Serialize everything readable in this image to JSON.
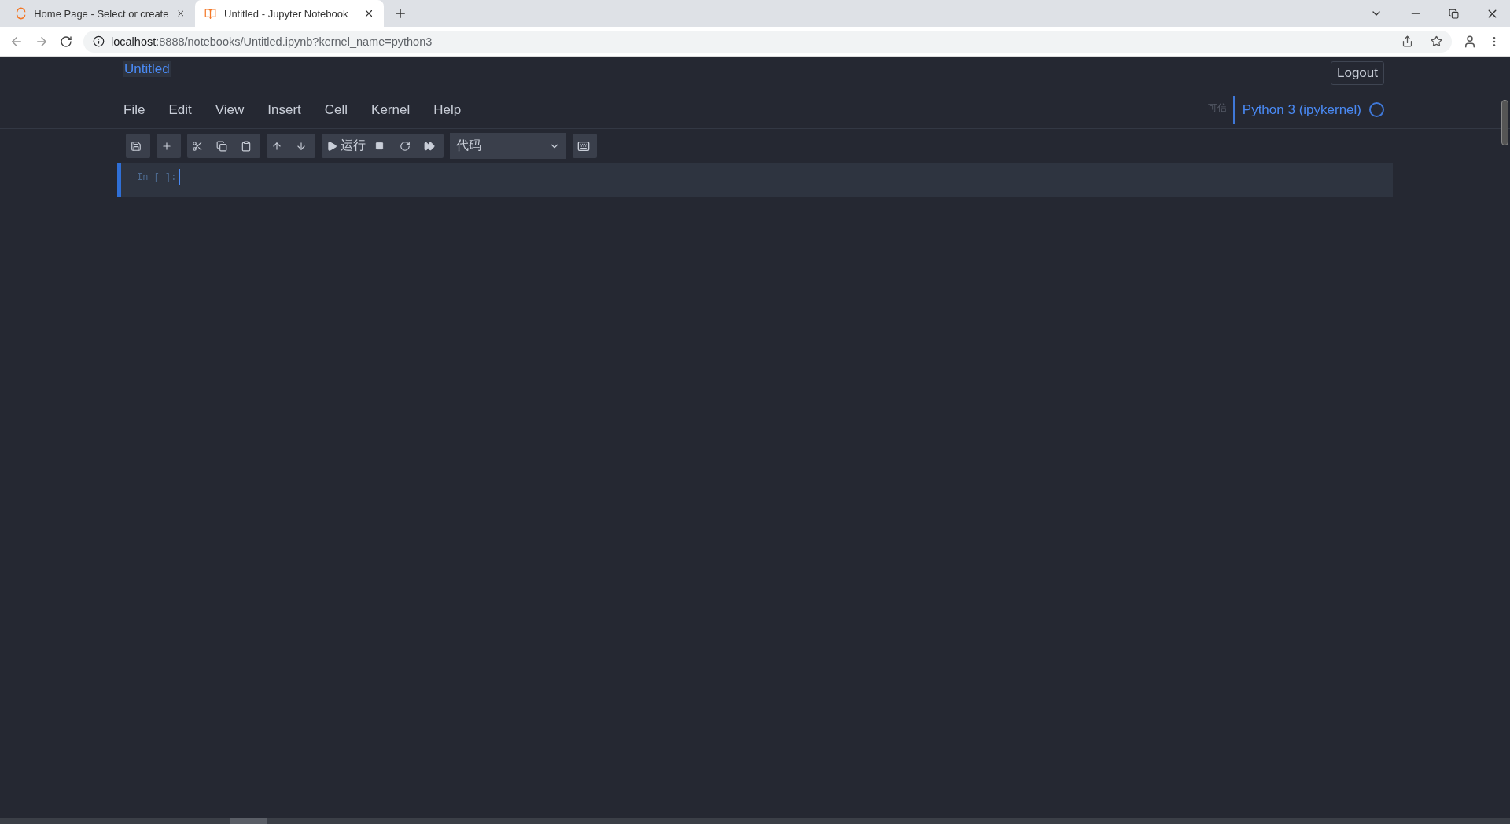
{
  "browser": {
    "tabs": [
      {
        "title": "Home Page - Select or create",
        "selected": false
      },
      {
        "title": "Untitled - Jupyter Notebook",
        "selected": true
      }
    ],
    "address": {
      "host": "localhost",
      "rest": ":8888/notebooks/Untitled.ipynb?kernel_name=python3"
    }
  },
  "notebook": {
    "title": "Untitled",
    "logout": "Logout",
    "menu": [
      "File",
      "Edit",
      "View",
      "Insert",
      "Cell",
      "Kernel",
      "Help"
    ],
    "trusted": "可信",
    "kernel": "Python 3 (ipykernel)",
    "kernel_busy": false
  },
  "toolbar": {
    "groups": [
      [
        {
          "kind": "save"
        }
      ],
      [
        {
          "kind": "add"
        }
      ],
      [
        {
          "kind": "cut"
        },
        {
          "kind": "copy"
        },
        {
          "kind": "paste"
        }
      ],
      [
        {
          "kind": "up"
        },
        {
          "kind": "down"
        }
      ],
      [
        {
          "kind": "run"
        },
        {
          "kind": "stop"
        },
        {
          "kind": "restart"
        },
        {
          "kind": "fastforward"
        }
      ]
    ],
    "run_label": "运行",
    "cell_type": "代码"
  },
  "cells": [
    {
      "prompt": "In [ ]:",
      "selected": true
    }
  ]
}
